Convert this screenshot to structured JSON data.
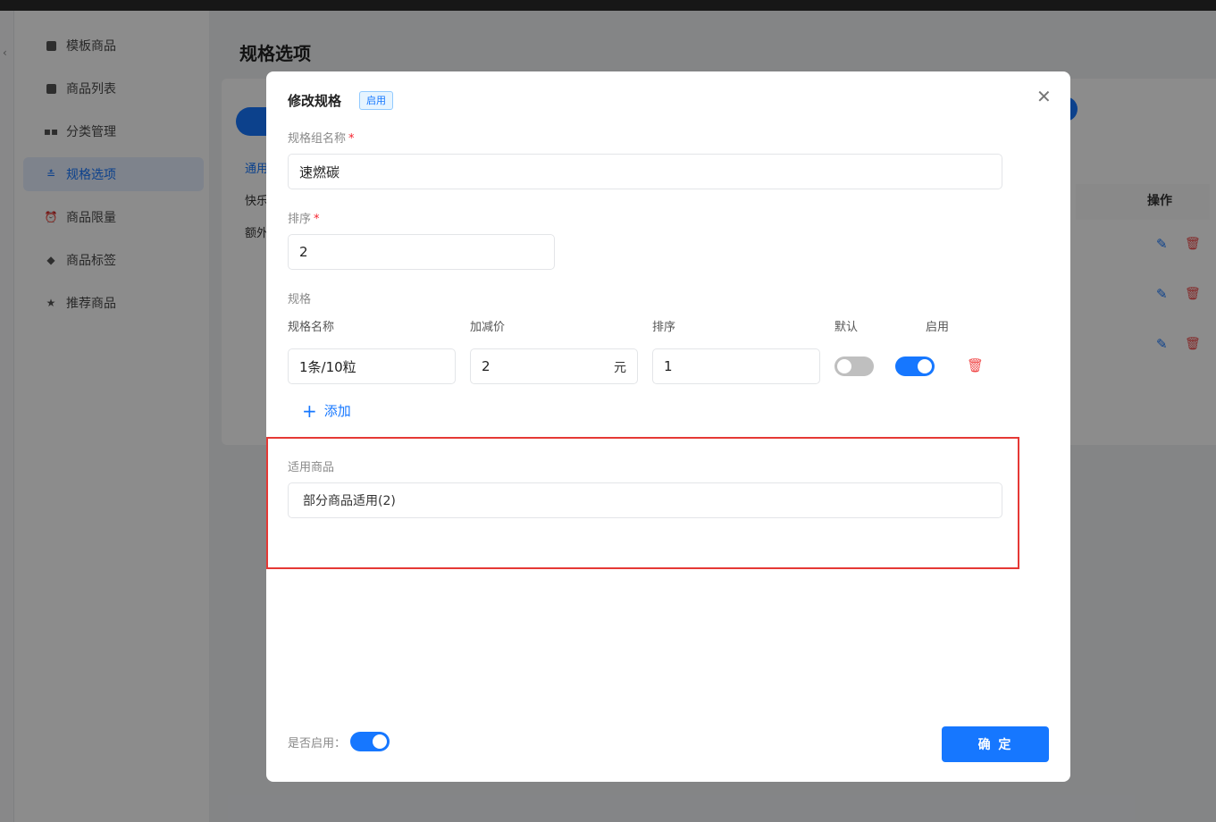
{
  "sidebar": {
    "items": [
      {
        "label": "模板商品",
        "icon": "bag-icon"
      },
      {
        "label": "商品列表",
        "icon": "bag-icon"
      },
      {
        "label": "分类管理",
        "icon": "grid-icon"
      },
      {
        "label": "规格选项",
        "icon": "spec-icon"
      },
      {
        "label": "商品限量",
        "icon": "alarm-icon"
      },
      {
        "label": "商品标签",
        "icon": "tag-icon"
      },
      {
        "label": "推荐商品",
        "icon": "star-icon"
      }
    ],
    "active_index": 3
  },
  "page": {
    "title": "规格选项",
    "tab_fragment": "通用",
    "rows": [
      "快乐",
      "额外"
    ],
    "operation_header": "操作"
  },
  "modal": {
    "title": "修改规格",
    "status_tag": "启用",
    "group_name_label": "规格组名称",
    "group_name_value": "速燃碳",
    "sort_label": "排序",
    "sort_value": "2",
    "spec_label": "规格",
    "columns": {
      "name": "规格名称",
      "price": "加减价",
      "sort": "排序",
      "default": "默认",
      "enabled": "启用"
    },
    "spec_row": {
      "name": "1条/10粒",
      "price": "2",
      "price_unit": "元",
      "sort": "1",
      "default_on": false,
      "enabled_on": true
    },
    "add_label": "添加",
    "applicable_label": "适用商品",
    "applicable_value": "部分商品适用(2)",
    "enable_label": "是否启用：",
    "enable_on": true,
    "confirm_label": "确 定"
  },
  "colors": {
    "accent": "#1677ff",
    "danger": "#f04747",
    "highlight_border": "#e53935"
  }
}
